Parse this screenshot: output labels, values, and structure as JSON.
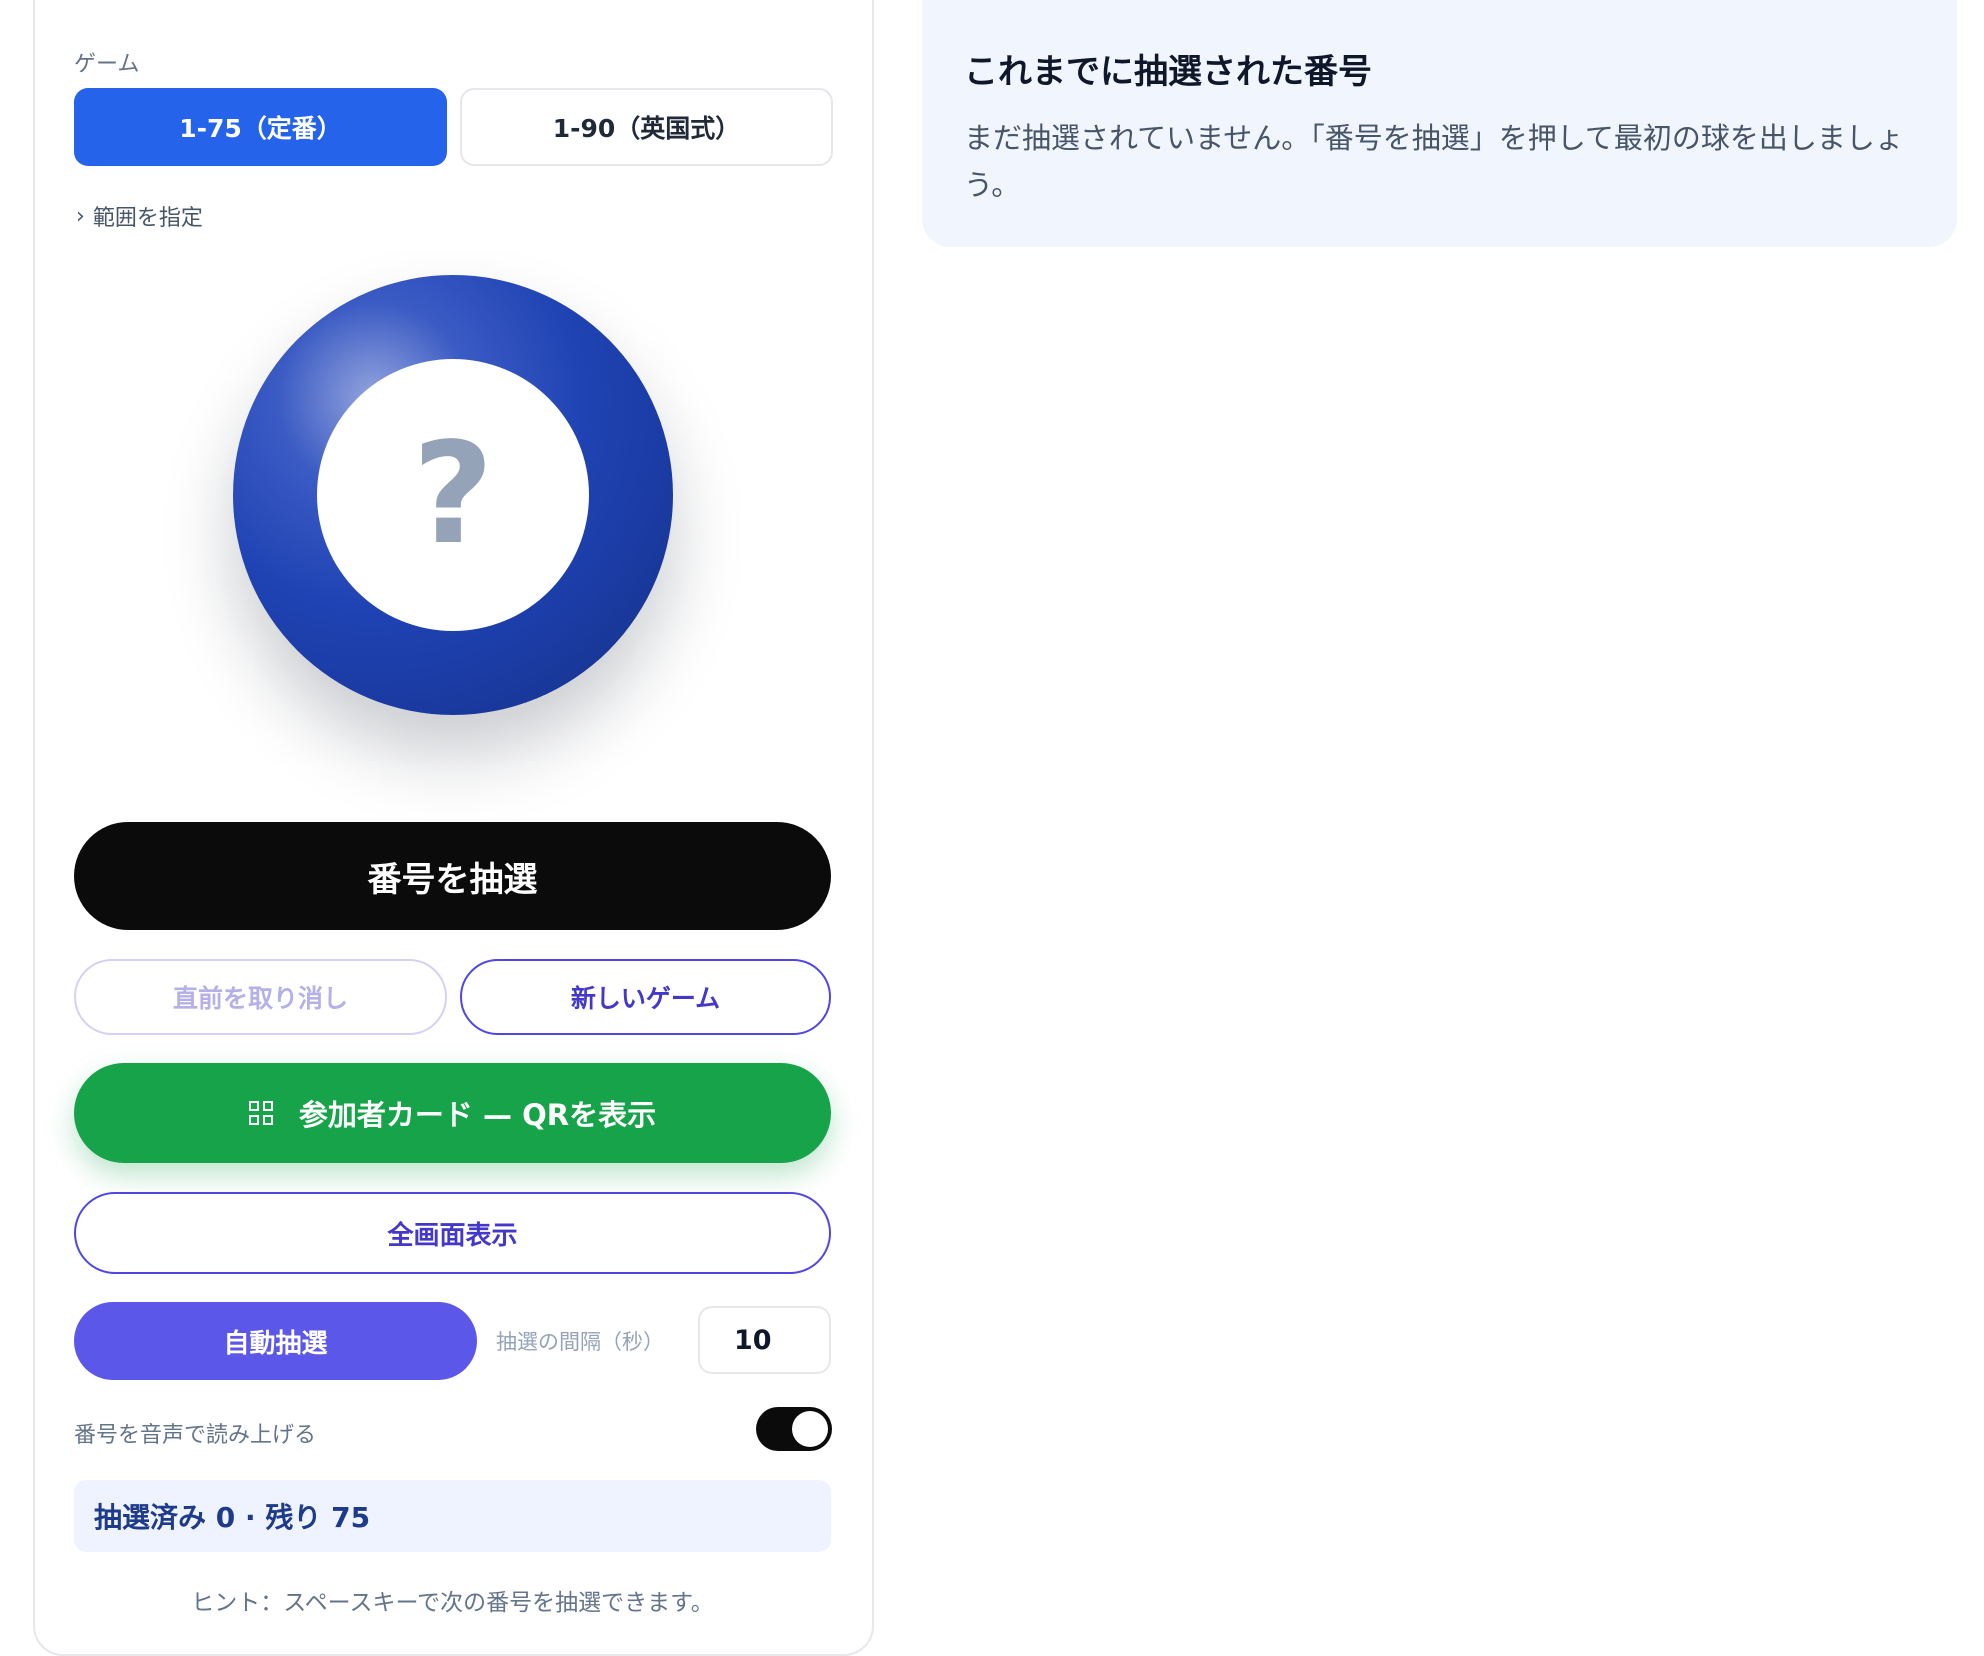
{
  "game": {
    "label": "ゲーム",
    "options": [
      {
        "label": "1-75（定番）",
        "active": true
      },
      {
        "label": "1-90（英国式）",
        "active": false
      }
    ],
    "range_toggle": "範囲を指定"
  },
  "ball": {
    "display": "?"
  },
  "actions": {
    "draw": "番号を抽選",
    "undo": "直前を取り消し",
    "new_game": "新しいゲーム",
    "qr": "参加者カード — QRを表示",
    "fullscreen": "全画面表示",
    "auto": "自動抽選"
  },
  "interval": {
    "label": "抽選の間隔（秒）",
    "value": "10"
  },
  "voice": {
    "label": "番号を音声で読み上げる",
    "enabled": true
  },
  "status": "抽選済み 0 · 残り 75",
  "hint": "ヒント：スペースキーで次の番号を抽選できます。",
  "history": {
    "title": "これまでに抽選された番号",
    "empty_message": "まだ抽選されていません。「番号を抽選」を押して最初の球を出しましょう。"
  },
  "colors": {
    "primary": "#2563eb",
    "indigo": "#4f46e5",
    "green": "#16a34a",
    "black": "#0b0b0b"
  }
}
